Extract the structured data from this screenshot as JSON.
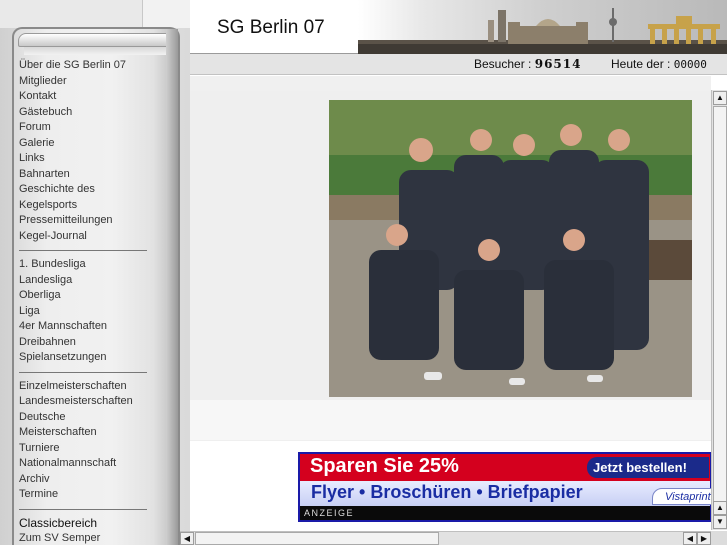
{
  "site": {
    "title": "SG Berlin 07"
  },
  "infobar": {
    "visitors_label": "Besucher :",
    "visitors_count": "96514",
    "today_label": "Heute der :",
    "today_count": "00000"
  },
  "menu": {
    "group1": [
      "Über die SG Berlin 07",
      "Mitglieder",
      "Kontakt",
      "Gästebuch",
      "Forum",
      "Galerie",
      "Links",
      "Bahnarten",
      "Geschichte des",
      "Kegelsports",
      "Pressemitteilungen",
      "Kegel-Journal"
    ],
    "group2": [
      "1. Bundesliga",
      "Landesliga",
      "Oberliga",
      "Liga",
      "4er Mannschaften",
      "Dreibahnen",
      "Spielansetzungen"
    ],
    "group3": [
      "Einzelmeisterschaften",
      "Landesmeisterschaften",
      "Deutsche",
      "Meisterschaften",
      "Turniere",
      "Nationalmannschaft",
      "Archiv",
      "Termine"
    ],
    "group4": [
      "Classicbereich",
      "Zum SV Semper"
    ]
  },
  "ad": {
    "headline": "Sparen Sie 25%",
    "cta": "Jetzt bestellen!",
    "products": "Flyer • Broschüren • Briefpapier",
    "brand": "Vistaprint",
    "label": "ANZEIGE"
  },
  "icons": {
    "scroll_up": "triangle-up",
    "scroll_down": "triangle-down",
    "scroll_left": "triangle-left",
    "scroll_right": "triangle-right"
  },
  "colors": {
    "ad_red": "#d4001e",
    "ad_blue": "#1a1aa8",
    "panel_grey": "#e6e6e6"
  }
}
